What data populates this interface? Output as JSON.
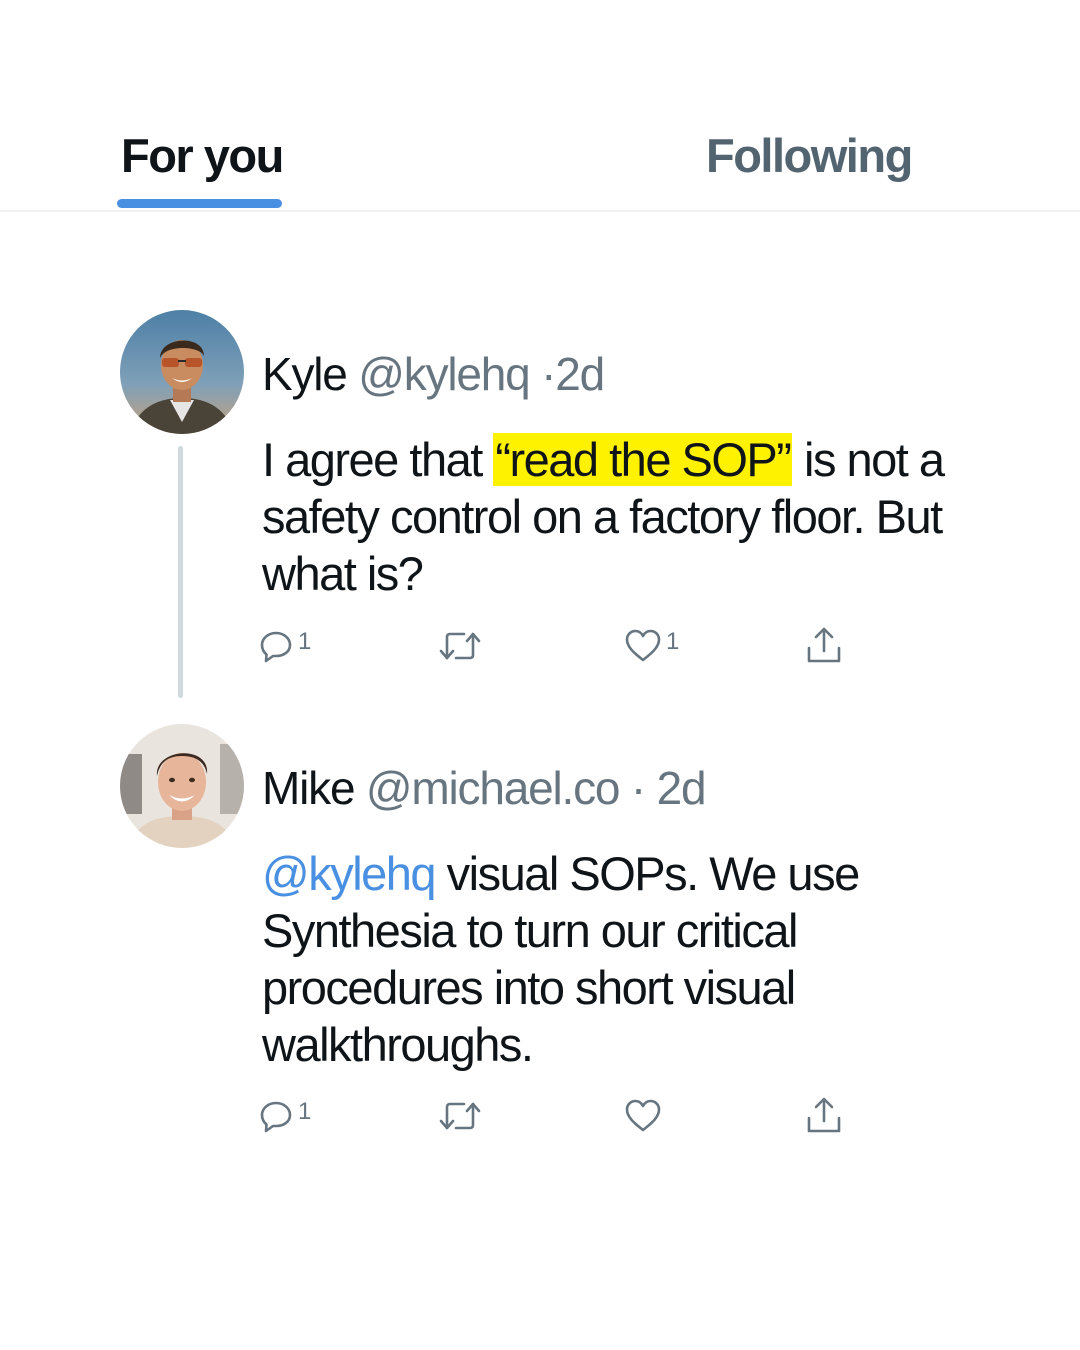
{
  "tabs": {
    "for_you": "For you",
    "following": "Following",
    "active": "For you",
    "indicator_color": "#4a90e2"
  },
  "posts": [
    {
      "name": "Kyle",
      "handle": "@kylehq",
      "time_sep": "·",
      "time": "2d",
      "body": {
        "before": "I agree that ",
        "highlight": "“read the SOP”",
        "after": " is not a safety control on a factory floor. But what is?"
      },
      "highlight_color": "#fff200",
      "actions": {
        "reply_icon": "reply-icon",
        "reply_count": "1",
        "retweet_icon": "retweet-icon",
        "like_icon": "heart-icon",
        "like_count": "1",
        "share_icon": "share-icon"
      }
    },
    {
      "name": "Mike",
      "handle": "@michael.co",
      "time_sep": "·",
      "time": "2d",
      "body": {
        "mention": "@kylehq",
        "text": " visual SOPs. We use Synthesia to turn our critical procedures into short visual walkthroughs."
      },
      "mention_color": "#4a90e2",
      "actions": {
        "reply_icon": "reply-icon",
        "reply_count": "1",
        "retweet_icon": "retweet-icon",
        "like_icon": "heart-icon",
        "like_count": "",
        "share_icon": "share-icon"
      }
    }
  ]
}
